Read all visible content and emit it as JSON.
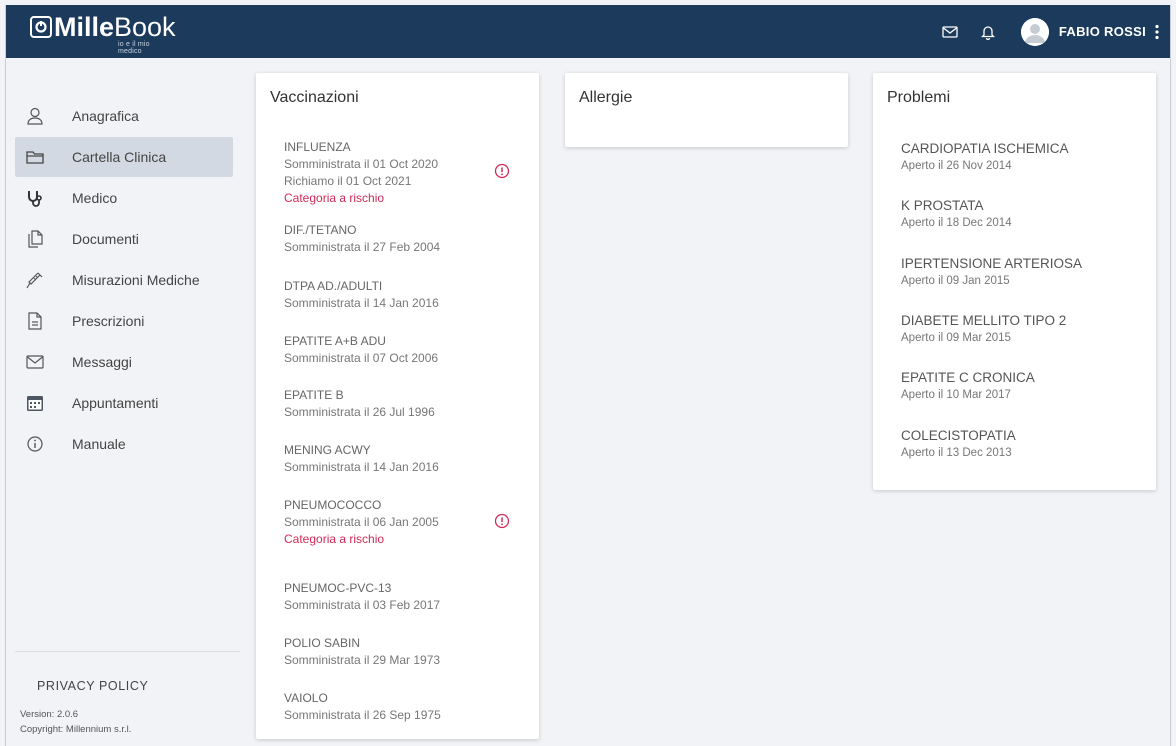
{
  "header": {
    "logo_mille": "Mille",
    "logo_book": "Book",
    "logo_tagline": "io e il mio medico",
    "user_name": "FABIO ROSSI"
  },
  "sidebar": {
    "items": [
      {
        "label": "Anagrafica",
        "icon": "user-icon"
      },
      {
        "label": "Cartella Clinica",
        "icon": "folder-icon",
        "active": true
      },
      {
        "label": "Medico",
        "icon": "stethoscope-icon"
      },
      {
        "label": "Documenti",
        "icon": "documents-icon"
      },
      {
        "label": "Misurazioni Mediche",
        "icon": "syringe-icon"
      },
      {
        "label": "Prescrizioni",
        "icon": "prescription-icon"
      },
      {
        "label": "Messaggi",
        "icon": "mail-icon"
      },
      {
        "label": "Appuntamenti",
        "icon": "calendar-icon"
      },
      {
        "label": "Manuale",
        "icon": "info-icon"
      }
    ],
    "privacy": "PRIVACY POLICY",
    "version": "Version: 2.0.6",
    "copyright": "Copyright: Millennium s.r.l."
  },
  "vaccinazioni": {
    "title": "Vaccinazioni",
    "items": [
      {
        "name": "INFLUENZA",
        "lines": [
          "Somministrata il 01 Oct 2020",
          "Richiamo il 01 Oct 2021"
        ],
        "risk": "Categoria a rischio",
        "alert": true
      },
      {
        "name": "DIF./TETANO",
        "lines": [
          "Somministrata il 27 Feb 2004"
        ]
      },
      {
        "name": "DTPA AD./ADULTI",
        "lines": [
          "Somministrata il 14 Jan 2016"
        ]
      },
      {
        "name": "EPATITE A+B ADU",
        "lines": [
          "Somministrata il 07 Oct 2006"
        ]
      },
      {
        "name": "EPATITE B",
        "lines": [
          "Somministrata il 26 Jul 1996"
        ]
      },
      {
        "name": "MENING ACWY",
        "lines": [
          "Somministrata il 14 Jan 2016"
        ]
      },
      {
        "name": "PNEUMOCOCCO",
        "lines": [
          "Somministrata il 06 Jan 2005"
        ],
        "risk": "Categoria a rischio",
        "alert": true
      },
      {
        "name": "PNEUMOC-PVC-13",
        "lines": [
          "Somministrata il 03 Feb 2017"
        ]
      },
      {
        "name": "POLIO SABIN",
        "lines": [
          "Somministrata il 29 Mar 1973"
        ]
      },
      {
        "name": "VAIOLO",
        "lines": [
          "Somministrata il 26 Sep 1975"
        ]
      }
    ]
  },
  "allergie": {
    "title": "Allergie"
  },
  "problemi": {
    "title": "Problemi",
    "items": [
      {
        "name": "CARDIOPATIA ISCHEMICA",
        "date": "Aperto il 26 Nov 2014"
      },
      {
        "name": "K PROSTATA",
        "date": "Aperto il 18 Dec 2014"
      },
      {
        "name": "IPERTENSIONE ARTERIOSA",
        "date": "Aperto il 09 Jan 2015"
      },
      {
        "name": "DIABETE MELLITO TIPO 2",
        "date": "Aperto il 09 Mar 2015"
      },
      {
        "name": "EPATITE C CRONICA",
        "date": "Aperto il 10 Mar 2017"
      },
      {
        "name": "COLECISTOPATIA",
        "date": "Aperto il 13 Dec 2013"
      }
    ]
  },
  "colors": {
    "header_bg": "#1c3a5b",
    "risk_text": "#d22a58",
    "active_nav_bg": "#d3d9e2"
  }
}
